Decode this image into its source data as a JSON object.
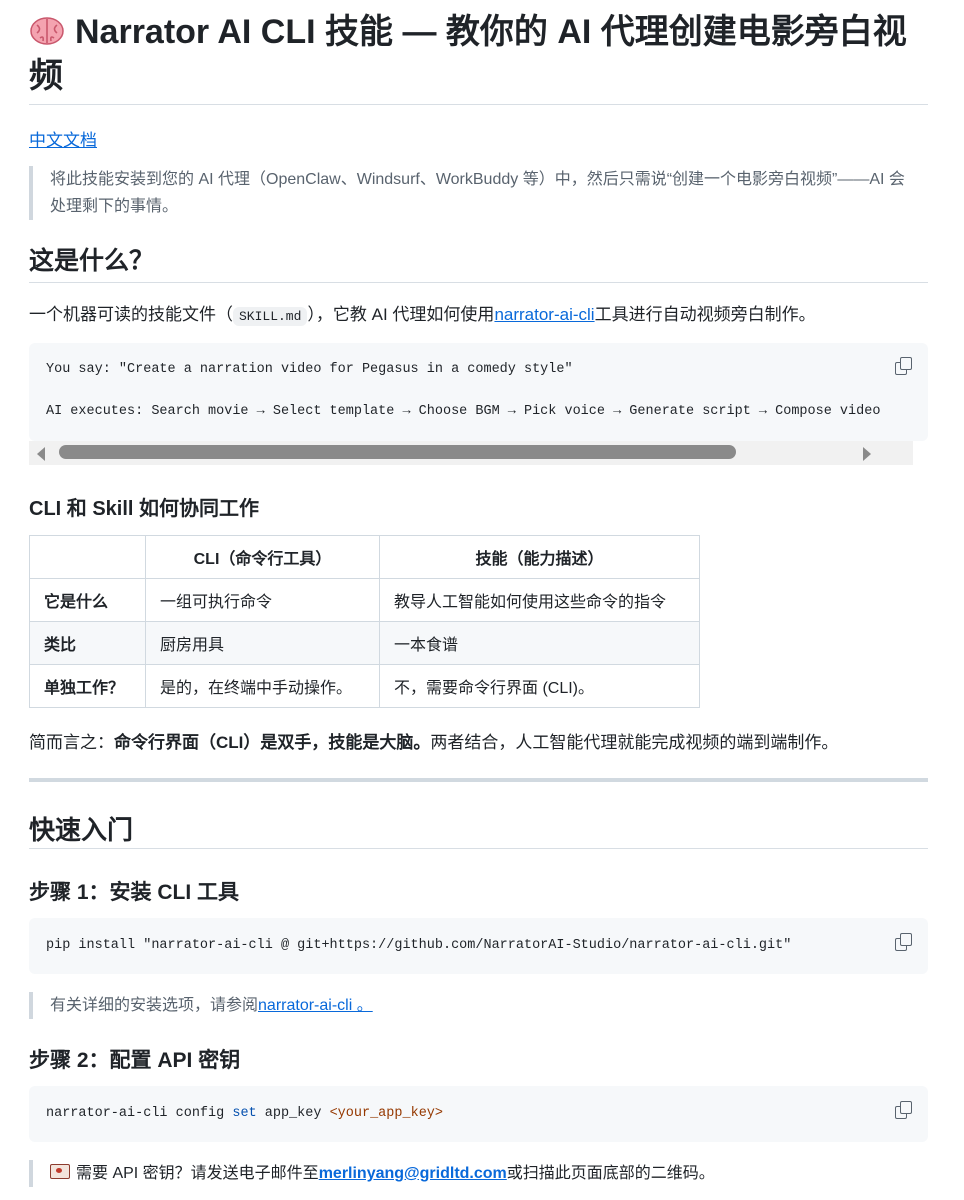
{
  "header": {
    "title": "Narrator AI CLI 技能 — 教你的 AI 代理创建电影旁白视频",
    "title_icon": "brain-emoji"
  },
  "lang_link": "中文文档",
  "intro_quote": "将此技能安装到您的 AI 代理（OpenClaw、Windsurf、WorkBuddy 等）中，然后只需说“创建一个电影旁白视频”——AI 会处理剩下的事情。",
  "section_what": {
    "heading": "这是什么？",
    "para_before": "一个机器可读的技能文件（",
    "inline_code": "SKILL.md",
    "para_middle": "），它教 AI 代理如何使用",
    "link": "narrator-ai-cli",
    "para_after": "工具进行自动视频旁白制作。",
    "code_lines": [
      "You say: \"Create a narration video for Pegasus in a comedy style\"",
      "AI executes: Search movie → Select template → Choose BGM → Pick voice → Generate script → Compose video →"
    ]
  },
  "section_how": {
    "heading": "CLI 和 Skill 如何协同工作",
    "table": {
      "headers": [
        "",
        "CLI（命令行工具）",
        "技能（能力描述）"
      ],
      "rows": [
        [
          "它是什么",
          "一组可执行命令",
          "教导人工智能如何使用这些命令的指令"
        ],
        [
          "类比",
          "厨房用具",
          "一本食谱"
        ],
        [
          "单独工作？",
          "是的，在终端中手动操作。",
          "不，需要命令行界面 (CLI)。"
        ]
      ]
    },
    "summary_prefix": "简而言之：",
    "summary_bold": "命令行界面（CLI）是双手，技能是大脑。",
    "summary_rest": "两者结合，人工智能代理就能完成视频的端到端制作。"
  },
  "section_quickstart": {
    "heading": "快速入门",
    "step1": {
      "heading": "步骤 1：安装 CLI 工具",
      "code": "pip install \"narrator-ai-cli @ git+https://github.com/NarratorAI-Studio/narrator-ai-cli.git\"",
      "note_prefix": "有关详细的安装选项，请参阅",
      "note_link": "narrator-ai-cli 。"
    },
    "step2": {
      "heading": "步骤 2：配置 API 密钥",
      "code_cmd": "narrator-ai-cli config ",
      "code_kw": "set",
      "code_arg": " app_key ",
      "code_ph": "<your_app_key>",
      "note_prefix": "需要 API 密钥？请发送电子邮件至",
      "note_email": "merlinyang@gridltd.com",
      "note_suffix": "或扫描此页面底部的二维码。",
      "note_icon": "email-icon"
    }
  },
  "copy_icon": "copy-icon"
}
